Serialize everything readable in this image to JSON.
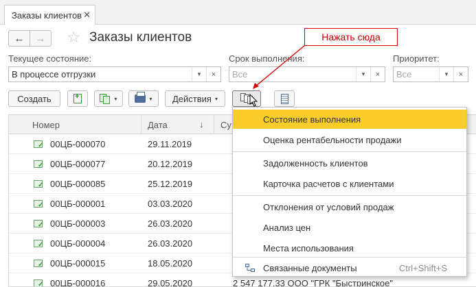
{
  "tab": {
    "label": "Заказы клиентов",
    "close": "✕"
  },
  "nav": {
    "back": "←",
    "forward": "→",
    "star": "☆"
  },
  "title": "Заказы клиентов",
  "filters": {
    "state": {
      "label": "Текущее состояние:",
      "value": "В процессе отгрузки"
    },
    "deadline": {
      "label": "Срок выполнения:",
      "placeholder": "Все"
    },
    "priority": {
      "label": "Приоритет:",
      "placeholder": "Все"
    },
    "dropdown_glyph": "▾",
    "clear_glyph": "×"
  },
  "toolbar": {
    "create_label": "Создать",
    "actions_label": "Действия",
    "caret": "▾"
  },
  "table": {
    "columns": {
      "number": "Номер",
      "date": "Дата",
      "sum": "Су",
      "sort": "↓"
    },
    "rows": [
      {
        "number": "00ЦБ-000070",
        "date": "29.11.2019",
        "sum": ""
      },
      {
        "number": "00ЦБ-000077",
        "date": "20.12.2019",
        "sum": ""
      },
      {
        "number": "00ЦБ-000085",
        "date": "25.12.2019",
        "sum": ""
      },
      {
        "number": "00ЦБ-000001",
        "date": "03.03.2020",
        "sum": ""
      },
      {
        "number": "00ЦБ-000003",
        "date": "26.03.2020",
        "sum": ""
      },
      {
        "number": "00ЦБ-000004",
        "date": "26.03.2020",
        "sum": ""
      },
      {
        "number": "00ЦБ-000015",
        "date": "18.05.2020",
        "sum": ""
      },
      {
        "number": "00ЦБ-000016",
        "date": "29.05.2020",
        "sum": "2 547 177,33     ООО \"ГРК \"Быстринское\""
      }
    ]
  },
  "menu": {
    "items": [
      {
        "label": "Состояние выполнения"
      },
      {
        "label": "Оценка рентабельности продажи"
      },
      {
        "label": "Задолженность клиентов"
      },
      {
        "label": "Карточка расчетов с клиентами"
      },
      {
        "label": "Отклонения от условий продаж"
      },
      {
        "label": "Анализ цен"
      },
      {
        "label": "Места использования"
      },
      {
        "label": "Связанные документы",
        "shortcut": "Ctrl+Shift+S"
      }
    ]
  },
  "callout": {
    "text": "Нажать сюда"
  },
  "colors": {
    "highlight": "#fbcd2b",
    "callout": "#d40000",
    "accent_green": "#2e9a2e"
  }
}
